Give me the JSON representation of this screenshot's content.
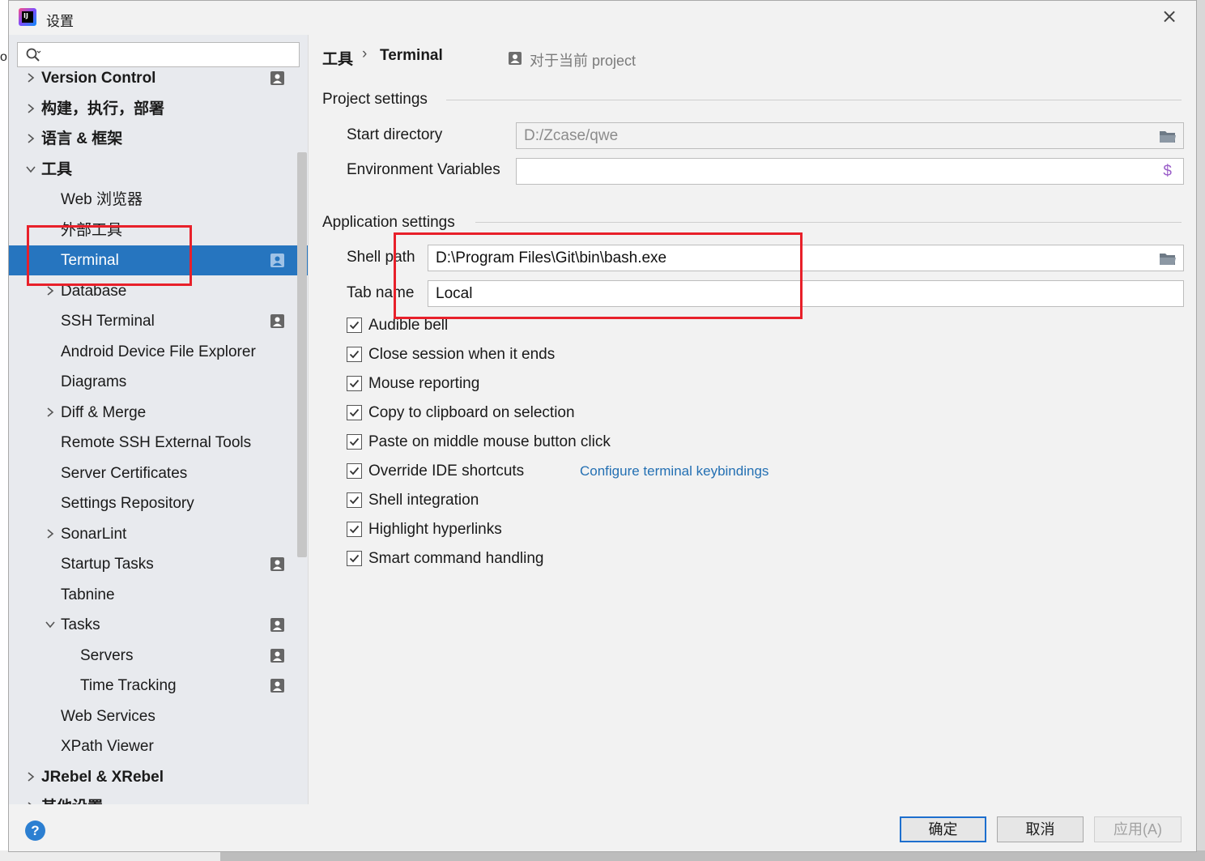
{
  "window": {
    "title": "设置",
    "app_icon_text": "IJ"
  },
  "search": {
    "placeholder": ""
  },
  "sidebar": {
    "items": [
      {
        "label": "Version Control",
        "level": 0,
        "arrow": "right",
        "badge": true
      },
      {
        "label": "构建，执行，部署",
        "level": 0,
        "arrow": "right",
        "badge": false
      },
      {
        "label": "语言 & 框架",
        "level": 0,
        "arrow": "right",
        "badge": false
      },
      {
        "label": "工具",
        "level": 0,
        "arrow": "down",
        "badge": false
      },
      {
        "label": "Web 浏览器",
        "level": 1,
        "arrow": "none",
        "badge": false
      },
      {
        "label": "外部工具",
        "level": 1,
        "arrow": "none",
        "badge": false
      },
      {
        "label": "Terminal",
        "level": 1,
        "arrow": "none",
        "badge": true,
        "selected": true
      },
      {
        "label": "Database",
        "level": 1,
        "arrow": "right",
        "badge": false
      },
      {
        "label": "SSH Terminal",
        "level": 1,
        "arrow": "none",
        "badge": true
      },
      {
        "label": "Android Device File Explorer",
        "level": 1,
        "arrow": "none",
        "badge": false
      },
      {
        "label": "Diagrams",
        "level": 1,
        "arrow": "none",
        "badge": false
      },
      {
        "label": "Diff & Merge",
        "level": 1,
        "arrow": "right",
        "badge": false
      },
      {
        "label": "Remote SSH External Tools",
        "level": 1,
        "arrow": "none",
        "badge": false
      },
      {
        "label": "Server Certificates",
        "level": 1,
        "arrow": "none",
        "badge": false
      },
      {
        "label": "Settings Repository",
        "level": 1,
        "arrow": "none",
        "badge": false
      },
      {
        "label": "SonarLint",
        "level": 1,
        "arrow": "right",
        "badge": false
      },
      {
        "label": "Startup Tasks",
        "level": 1,
        "arrow": "none",
        "badge": true
      },
      {
        "label": "Tabnine",
        "level": 1,
        "arrow": "none",
        "badge": false
      },
      {
        "label": "Tasks",
        "level": 1,
        "arrow": "down",
        "badge": true
      },
      {
        "label": "Servers",
        "level": 2,
        "arrow": "none",
        "badge": true
      },
      {
        "label": "Time Tracking",
        "level": 2,
        "arrow": "none",
        "badge": true
      },
      {
        "label": "Web Services",
        "level": 1,
        "arrow": "none",
        "badge": false
      },
      {
        "label": "XPath Viewer",
        "level": 1,
        "arrow": "none",
        "badge": false
      },
      {
        "label": "JRebel & XRebel",
        "level": 0,
        "arrow": "right",
        "badge": false
      },
      {
        "label": "其他设置",
        "level": 0,
        "arrow": "right",
        "badge": false
      }
    ]
  },
  "breadcrumb": {
    "parent": "工具",
    "separator": "›",
    "current": "Terminal",
    "scope": "对于当前 project"
  },
  "project_settings": {
    "title": "Project settings",
    "start_directory": {
      "label": "Start directory",
      "value": "D:/Zcase/qwe"
    },
    "env_vars": {
      "label": "Environment Variables",
      "value": "",
      "icon": "$"
    }
  },
  "application_settings": {
    "title": "Application settings",
    "shell_path": {
      "label": "Shell path",
      "value": "D:\\Program Files\\Git\\bin\\bash.exe"
    },
    "tab_name": {
      "label": "Tab name",
      "value": "Local"
    },
    "checkboxes": [
      {
        "label": "Audible bell",
        "checked": true
      },
      {
        "label": "Close session when it ends",
        "checked": true
      },
      {
        "label": "Mouse reporting",
        "checked": true
      },
      {
        "label": "Copy to clipboard on selection",
        "checked": true
      },
      {
        "label": "Paste on middle mouse button click",
        "checked": true
      },
      {
        "label": "Override IDE shortcuts",
        "checked": true,
        "link": "Configure terminal keybindings"
      },
      {
        "label": "Shell integration",
        "checked": true
      },
      {
        "label": "Highlight hyperlinks",
        "checked": true
      },
      {
        "label": "Smart command handling",
        "checked": true
      }
    ]
  },
  "buttons": {
    "ok": "确定",
    "cancel": "取消",
    "apply": "应用(A)",
    "help": "?"
  },
  "colors": {
    "selection": "#2675bf",
    "link": "#2470b3",
    "annotation": "#e8202a",
    "primary_border": "#1d6fce"
  }
}
